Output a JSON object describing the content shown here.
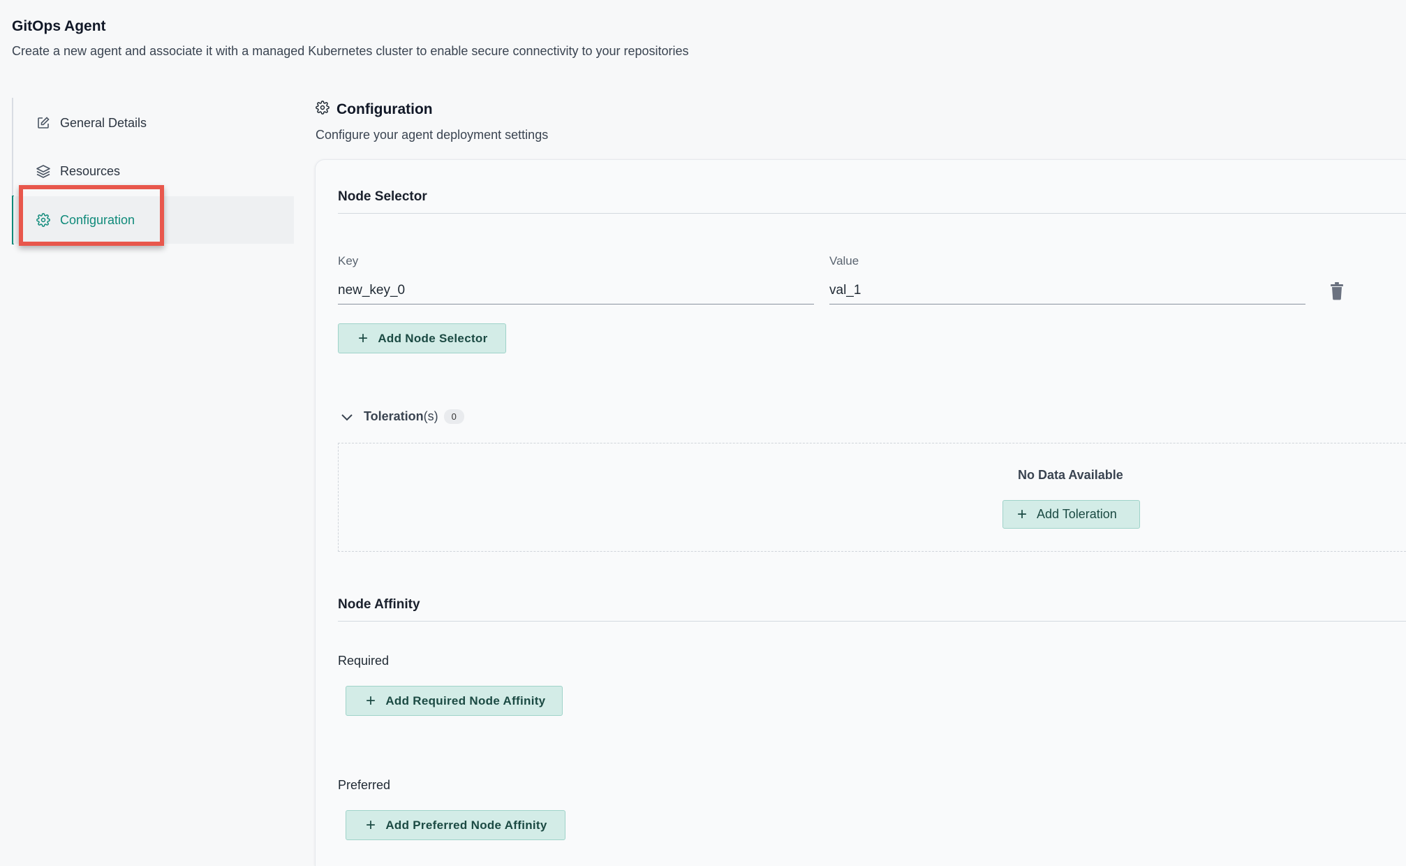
{
  "page": {
    "title": "GitOps Agent",
    "subtitle": "Create a new agent and associate it with a managed Kubernetes cluster to enable secure connectivity to your repositories"
  },
  "sidebar": {
    "items": [
      {
        "label": "General Details",
        "icon": "edit-icon",
        "active": false
      },
      {
        "label": "Resources",
        "icon": "layers-icon",
        "active": false
      },
      {
        "label": "Configuration",
        "icon": "gear-icon",
        "active": true
      }
    ]
  },
  "main": {
    "title": "Configuration",
    "subtitle": "Configure your agent deployment settings",
    "node_selector": {
      "title": "Node Selector",
      "key_label": "Key",
      "value_label": "Value",
      "key_value": "new_key_0",
      "value_value": "val_1",
      "add_button": "Add Node Selector"
    },
    "tolerations": {
      "label": "Toleration",
      "suffix": "(s)",
      "count": "0",
      "empty_text": "No Data Available",
      "add_button": "Add Toleration"
    },
    "node_affinity": {
      "title": "Node Affinity",
      "required_label": "Required",
      "required_button": "Add Required Node Affinity",
      "preferred_label": "Preferred",
      "preferred_button": "Add Preferred Node Affinity"
    }
  },
  "colors": {
    "accent": "#0f8a7a",
    "button_bg": "#d3ece7",
    "highlight": "#e8574c"
  }
}
